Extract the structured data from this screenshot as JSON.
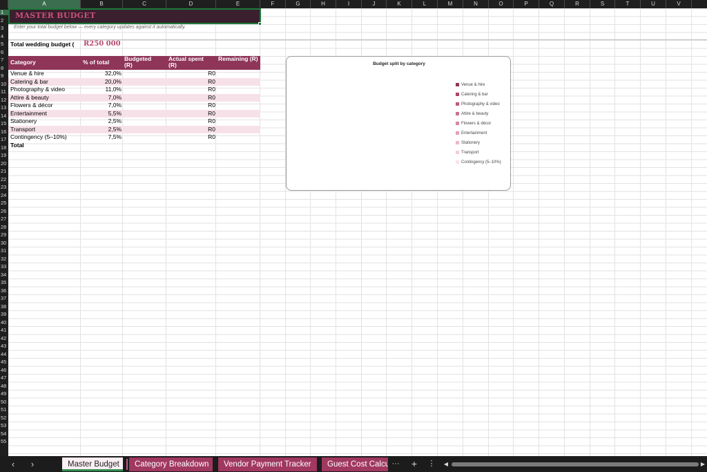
{
  "columns": [
    "A",
    "B",
    "C",
    "D",
    "E",
    "F",
    "G",
    "H",
    "I",
    "J",
    "K",
    "L",
    "M",
    "N",
    "O",
    "P",
    "Q",
    "R",
    "S",
    "T",
    "U",
    "V"
  ],
  "rows_visible": [
    "1",
    "2",
    "3",
    "4",
    "5",
    "6",
    "7",
    "8",
    "9",
    "10",
    "11",
    "12",
    "13",
    "14",
    "15",
    "16",
    "17",
    "18",
    "19",
    "20",
    "21",
    "22",
    "23",
    "24",
    "25",
    "26",
    "27",
    "28",
    "29",
    "30",
    "31",
    "32",
    "33",
    "34",
    "35",
    "36",
    "37",
    "38",
    "39",
    "40",
    "41",
    "42",
    "43",
    "44",
    "45",
    "46",
    "47",
    "48",
    "49",
    "50",
    "51",
    "52",
    "53",
    "54",
    "55"
  ],
  "sheet": {
    "title": "MASTER BUDGET",
    "instruction": "Enter your total budget below — every category updates against it automatically.",
    "total_budget_label": "Total wedding budget (",
    "total_budget_value": "R250 000"
  },
  "table": {
    "headers": [
      "Category",
      "% of total",
      "Budgeted (R)",
      "Actual spent (R)",
      "Remaining (R)"
    ],
    "rows": [
      {
        "category": "Venue & hire",
        "pct": "32,0%",
        "actual": "R0"
      },
      {
        "category": "Catering & bar",
        "pct": "20,0%",
        "actual": "R0"
      },
      {
        "category": "Photography & video",
        "pct": "11,0%",
        "actual": "R0"
      },
      {
        "category": "Attire & beauty",
        "pct": "7,0%",
        "actual": "R0"
      },
      {
        "category": "Flowers & décor",
        "pct": "7,0%",
        "actual": "R0"
      },
      {
        "category": "Entertainment",
        "pct": "5,5%",
        "actual": "R0"
      },
      {
        "category": "Stationery",
        "pct": "2,5%",
        "actual": "R0"
      },
      {
        "category": "Transport",
        "pct": "2,5%",
        "actual": "R0"
      },
      {
        "category": "Contingency (5–10%)",
        "pct": "7,5%",
        "actual": "R0"
      }
    ],
    "total_label": "Total"
  },
  "chart_data": {
    "type": "pie",
    "title": "Budget split by category",
    "legend_position": "right",
    "categories": [
      "Venue & hire",
      "Catering & bar",
      "Photography & video",
      "Attire & beauty",
      "Flowers & décor",
      "Entertainment",
      "Stationery",
      "Transport",
      "Contingency (5–10%)"
    ],
    "values": [
      0,
      0,
      0,
      0,
      0,
      0,
      0,
      0,
      0
    ],
    "colors": [
      "#8e3558",
      "#a8486d",
      "#bb5c80",
      "#c97393",
      "#d689a6",
      "#e2a1b8",
      "#ebb9ca",
      "#f2cfdb",
      "#f8e3ea"
    ]
  },
  "tabs": [
    {
      "label": "Master Budget",
      "active": true
    },
    {
      "label": "Category Breakdown",
      "active": false
    },
    {
      "label": "Vendor Payment Tracker",
      "active": false
    },
    {
      "label": "Guest Cost Calcu",
      "active": false
    }
  ],
  "nav": {
    "prev": "‹",
    "next": "›",
    "more": "···",
    "add": "+",
    "menu": "⋮"
  }
}
